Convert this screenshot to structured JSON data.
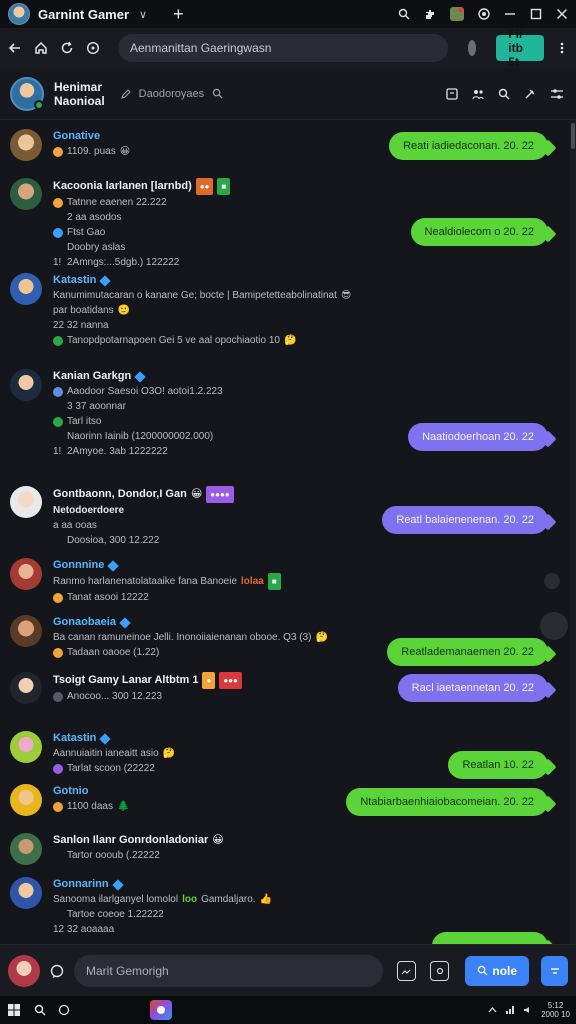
{
  "browser": {
    "tab_title": "Garnint Gamer",
    "tab_chevron": "∨",
    "address_text": "Aenmanittan Gaeringwasn",
    "action_button": "Fli itb 5t"
  },
  "channel": {
    "title_line1": "Henimar",
    "title_line2": "Naonioal",
    "subtitle": "Daodoroyaes"
  },
  "messages": [
    {
      "name": "Gonative",
      "name_color": "#58b8ff",
      "lines": [
        {
          "text": "1109. puas",
          "icon_color": "#f0a43a",
          "emoji": "😀"
        }
      ],
      "reply": {
        "text": "Reati iadiedaconan. 20. 22",
        "style": "green"
      }
    },
    {
      "name": "Kacoonia larlanen [larnbd)",
      "name_color": "#f0f1f4",
      "badges": [
        {
          "text": "●●",
          "color": "#e06a2a"
        },
        {
          "text": "■",
          "color": "#29a84a"
        }
      ],
      "lines": [
        {
          "text": "Tatnne eaenen 22.222",
          "icon_color": "#f0a43a"
        },
        {
          "text": "2 aa asodos",
          "icon_color": ""
        },
        {
          "text": "Ftst Gao",
          "icon_color": "#3aa0ff"
        },
        {
          "text": "Doobry aslas",
          "icon_color": ""
        },
        {
          "text": "2Amngs:...5dgb.) 122222",
          "icon_color": ""
        }
      ],
      "reply": {
        "text": "Nealdiolecom o 20. 22",
        "style": "green"
      }
    },
    {
      "name": "Katastin",
      "name_color": "#58b8ff",
      "verified": true,
      "lines": [
        {
          "text": "Kanumimutacaran o kanane Ge; bocte | Bamipetetteabolinatinat",
          "icon_color": "",
          "emoji": "😎"
        },
        {
          "text": "par boatidans",
          "icon_color": "",
          "emoji": "🙂"
        },
        {
          "text": "22 32 nanna",
          "icon_color": ""
        },
        {
          "text": "Tanopdpotarnapoen Gei 5 ve aal opochiaotio 10",
          "icon_color": "#29a84a",
          "emoji": "🤔"
        }
      ]
    },
    {
      "name": "Kanian Garkgn",
      "name_color": "#f0f1f4",
      "verified": true,
      "lines": [
        {
          "text": "Aaodoor Saesoi O3O! aotoi1.2.223",
          "icon_color": "#5e8fe0"
        },
        {
          "text": "3 37 aoonnar",
          "icon_color": ""
        },
        {
          "text": "Tarl itso",
          "icon_color": "#29a84a"
        },
        {
          "text": "Naorinn Iainib (1200000002.000)",
          "icon_color": ""
        },
        {
          "text": "2Amyoe. 3ab 1222222",
          "icon_color": ""
        }
      ],
      "reply": {
        "text": "Naatiodoerhoan 20. 22",
        "style": "purple"
      }
    },
    {
      "name": "Gontbaonn, Dondor,I Gan",
      "name_color": "#f0f1f4",
      "badges": [
        {
          "text": "●●●●",
          "color": "#9b5de5"
        }
      ],
      "emoji": "😀",
      "lines": [
        {
          "text": "Netodoerdoere",
          "icon_color": "",
          "bold": true
        },
        {
          "text": "a aa ooas",
          "icon_color": ""
        },
        {
          "text": "Doosioa, 300 12.222",
          "icon_color": ""
        }
      ],
      "reply": {
        "text": "Reatl balaienenenan. 20. 22",
        "style": "purple"
      }
    },
    {
      "name": "Gonnnine",
      "name_color": "#58b8ff",
      "verified": true,
      "lines": [
        {
          "text": "Ranmo harlanenatolataaike fana Banoeie",
          "icon_color": "",
          "trail": "lolaa",
          "trail_color": "#e06a2a"
        },
        {
          "text": "Tanat asooi 12222",
          "icon_color": "#f0a43a"
        }
      ]
    },
    {
      "name": "Gonaobaeia",
      "name_color": "#58b8ff",
      "verified": true,
      "lines": [
        {
          "text": "Ba canan ramuneinoe Jelli. Inonoiiaienanan obooe. Q3 (3)",
          "icon_color": "",
          "emoji": "🤔"
        },
        {
          "text": "Tadaan oaooe (1.22)",
          "icon_color": "#f0a43a"
        }
      ],
      "reply": {
        "text": "Reatlademanaemen 20. 22",
        "style": "green"
      }
    },
    {
      "name": "Tsoigt Gamy Lanar Altbtm 1",
      "name_color": "#f0f1f4",
      "badges": [
        {
          "text": "●",
          "color": "#f0a43a"
        },
        {
          "text": "●●●",
          "color": "#d9393a"
        }
      ],
      "lines": [
        {
          "text": "Anocoo... 300 12.223",
          "icon_color": ""
        }
      ],
      "reply": {
        "text": "Racl iaetaennetan 20. 22",
        "style": "purple"
      }
    },
    {
      "name": "Katastin",
      "name_color": "#58b8ff",
      "verified": true,
      "lines": [
        {
          "text": "Aannuiaitin ianeaitt asio",
          "icon_color": "",
          "emoji": "🤔"
        },
        {
          "text": "Tarlat scoon (22222",
          "icon_color": "#9b5de5"
        }
      ],
      "reply": {
        "text": "Reatlan 10. 22",
        "style": "green"
      }
    },
    {
      "name": "Gotnio",
      "name_color": "#58b8ff",
      "lines": [
        {
          "text": "1100 daas",
          "icon_color": "#f0a43a",
          "emoji": "🌲"
        }
      ],
      "reply": {
        "text": "Ntabiarbaenhiaiobacomeian. 20. 22",
        "style": "green"
      }
    },
    {
      "name": "Sanlon Ilanr Gonrdonladoniar",
      "name_color": "#f0f1f4",
      "emoji": "😀",
      "lines": [
        {
          "text": "Tartor oooub (.22222",
          "icon_color": ""
        }
      ]
    },
    {
      "name": "Gonnarinn",
      "name_color": "#58b8ff",
      "verified": true,
      "lines": [
        {
          "text": "Sanooma ilarlganyel lomolol",
          "icon_color": "",
          "trail": "loo",
          "trail_color": "#5bd43a",
          "after": "Gamdaljaro.",
          "emoji": "👍"
        },
        {
          "text": "Tartoe coeoe 1.22222",
          "icon_color": ""
        },
        {
          "text": "12 32 aoaaaa",
          "icon_color": ""
        }
      ]
    }
  ],
  "composer": {
    "placeholder": "Marit Gemorigh",
    "send_label": "nole"
  },
  "taskbar": {
    "clock_line1": "5:12",
    "clock_line2": "2000 10"
  }
}
